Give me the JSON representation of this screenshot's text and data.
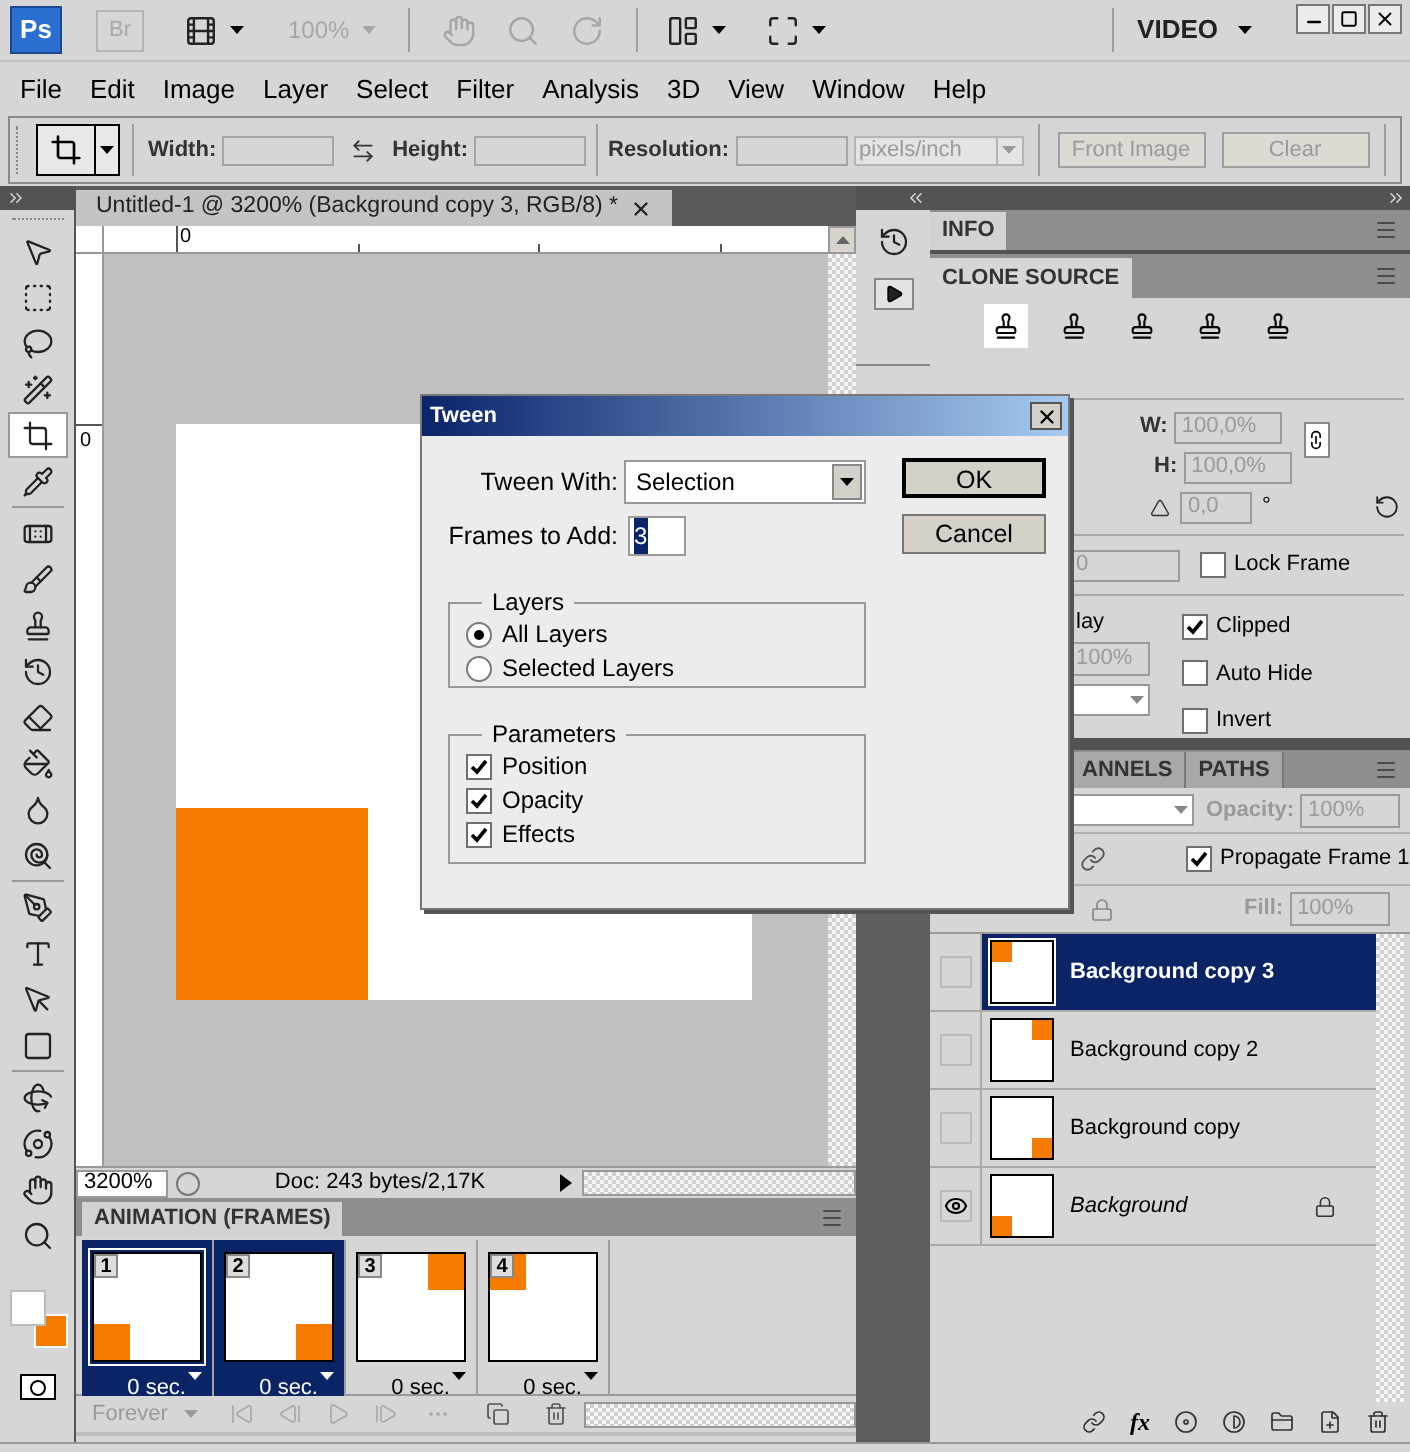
{
  "app_bar": {
    "logo": "Ps",
    "bridge": "Br",
    "zoom": "100%",
    "workspace": "VIDEO"
  },
  "menu": [
    "File",
    "Edit",
    "Image",
    "Layer",
    "Select",
    "Filter",
    "Analysis",
    "3D",
    "View",
    "Window",
    "Help"
  ],
  "options_bar": {
    "width_label": "Width:",
    "height_label": "Height:",
    "resolution_label": "Resolution:",
    "units": "pixels/inch",
    "buttons": [
      "Front Image",
      "Clear"
    ]
  },
  "tools": [
    {
      "selected": false
    },
    {
      "selected": false
    },
    {
      "selected": false
    },
    {
      "selected": false
    },
    {
      "selected": true
    },
    {
      "selected": false
    },
    {
      "selected": false
    },
    {
      "selected": false
    },
    {
      "selected": false
    },
    {
      "selected": false
    },
    {
      "selected": false
    },
    {
      "selected": false
    },
    {
      "selected": false
    },
    {
      "selected": false
    },
    {
      "selected": false
    },
    {
      "selected": false
    },
    {
      "selected": false
    },
    {
      "selected": false
    },
    {
      "selected": false
    },
    {
      "selected": false
    },
    {
      "selected": false
    },
    {
      "selected": false
    }
  ],
  "document": {
    "tab_title": "Untitled-1 @ 3200% (Background copy 3, RGB/8) *",
    "ruler_h": "0",
    "ruler_v": "0",
    "zoom": "3200%",
    "doc_info": "Doc: 243 bytes/2,17K"
  },
  "animation": {
    "title": "ANIMATION (FRAMES)",
    "loop": "Forever",
    "frames": [
      {
        "number": "1",
        "delay": "0 sec.",
        "selected": true,
        "current": true,
        "kind": "bottomleft"
      },
      {
        "number": "2",
        "delay": "0 sec.",
        "selected": true,
        "current": false,
        "kind": "bottomright"
      },
      {
        "number": "3",
        "delay": "0 sec.",
        "selected": false,
        "current": false,
        "kind": "topright"
      },
      {
        "number": "4",
        "delay": "0 sec.",
        "selected": false,
        "current": false,
        "kind": "topleft"
      }
    ]
  },
  "clone_source": {
    "tabs": [
      "INFO",
      "CLONE SOURCE"
    ],
    "w_label": "W:",
    "w_value": "100,0%",
    "h_label": "H:",
    "h_value": "100,0%",
    "angle_value": "0,0",
    "degree": "°",
    "offset_value": "0",
    "lock_frame": {
      "label": "Lock Frame",
      "checked": false
    },
    "overlay_fragment": "lay",
    "overlay_opacity": "100%",
    "options": [
      {
        "label": "Clipped",
        "checked": true
      },
      {
        "label": "Auto Hide",
        "checked": false
      },
      {
        "label": "Invert",
        "checked": false
      }
    ]
  },
  "layers_panel": {
    "tabs": [
      "ANNELS",
      "PATHS"
    ],
    "opacity_label": "Opacity:",
    "opacity": "100%",
    "propagate": {
      "label": "Propagate Frame 1",
      "checked": true
    },
    "fill_label": "Fill:",
    "fill": "100%",
    "fx": "fx",
    "layers": [
      {
        "name": "Background copy 3",
        "kind": "topleft",
        "locked": false,
        "selected": true,
        "visible": false
      },
      {
        "name": "Background copy 2",
        "kind": "topright",
        "locked": false,
        "selected": false,
        "visible": false
      },
      {
        "name": "Background copy",
        "kind": "bottomright",
        "locked": false,
        "selected": false,
        "visible": false
      },
      {
        "name": "Background",
        "kind": "bottomleft",
        "locked": true,
        "selected": false,
        "visible": true
      }
    ]
  },
  "dialog": {
    "title": "Tween",
    "tween_with_label": "Tween With:",
    "tween_with": "Selection",
    "frames_label": "Frames to Add:",
    "frames_value": "3",
    "buttons": [
      "OK",
      "Cancel"
    ],
    "layers_group": {
      "title": "Layers",
      "options": [
        {
          "label": "All Layers",
          "selected": true
        },
        {
          "label": "Selected Layers",
          "selected": false
        }
      ]
    },
    "parameters_group": {
      "title": "Parameters",
      "options": [
        {
          "label": "Position",
          "checked": true
        },
        {
          "label": "Opacity",
          "checked": true
        },
        {
          "label": "Effects",
          "checked": true
        }
      ]
    }
  }
}
